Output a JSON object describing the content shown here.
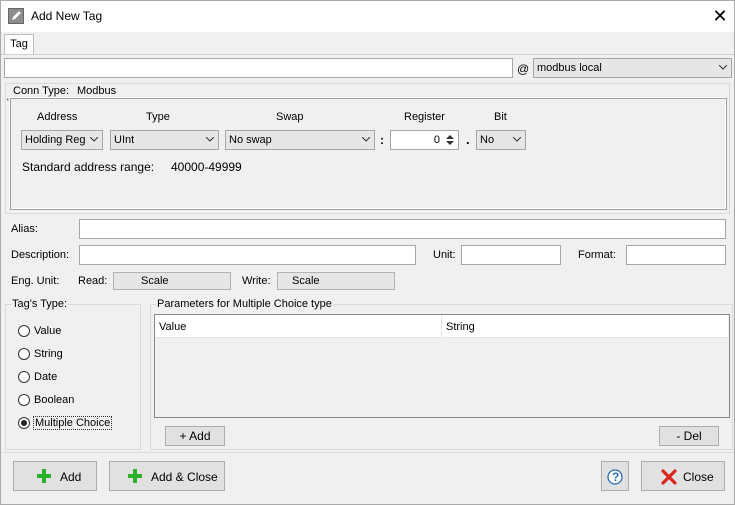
{
  "window": {
    "title": "Add New Tag"
  },
  "tabs": [
    {
      "label": "Tag"
    }
  ],
  "tag_row": {
    "name_value": "",
    "at_symbol": "@",
    "connection": "modbus local"
  },
  "conn": {
    "label": "Conn Type:",
    "value": "Modbus",
    "small_mark": "'"
  },
  "address_section": {
    "headers": {
      "address": "Address",
      "type": "Type",
      "swap": "Swap",
      "register": "Register",
      "bit": "Bit"
    },
    "address": "Holding Reg",
    "type": "UInt",
    "swap": "No swap",
    "colon": ":",
    "register": "0",
    "dot": ".",
    "bit": "No",
    "range_label": "Standard address range:",
    "range_value": "40000-49999"
  },
  "fields": {
    "alias_label": "Alias:",
    "alias_value": "",
    "description_label": "Description:",
    "description_value": "",
    "unit_label": "Unit:",
    "unit_value": "",
    "format_label": "Format:",
    "format_value": "",
    "eng_unit_label": "Eng. Unit:",
    "read_label": "Read:",
    "read_value": "Scale",
    "write_label": "Write:",
    "write_value": "Scale"
  },
  "tag_type": {
    "title": "Tag's Type:",
    "options": [
      "Value",
      "String",
      "Date",
      "Boolean",
      "Multiple Choice"
    ],
    "selected_index": 4
  },
  "params": {
    "title": "Parameters for Multiple Choice type",
    "columns": [
      "Value",
      "String"
    ],
    "add_label": "+ Add",
    "del_label": "- Del"
  },
  "footer": {
    "add_label": "Add",
    "add_close_label": "Add & Close",
    "help_symbol": "?",
    "close_label": "Close"
  },
  "colors": {
    "plus_green": "#2bb02b",
    "close_red": "#d9261c",
    "help_blue": "#2a6ebb"
  }
}
